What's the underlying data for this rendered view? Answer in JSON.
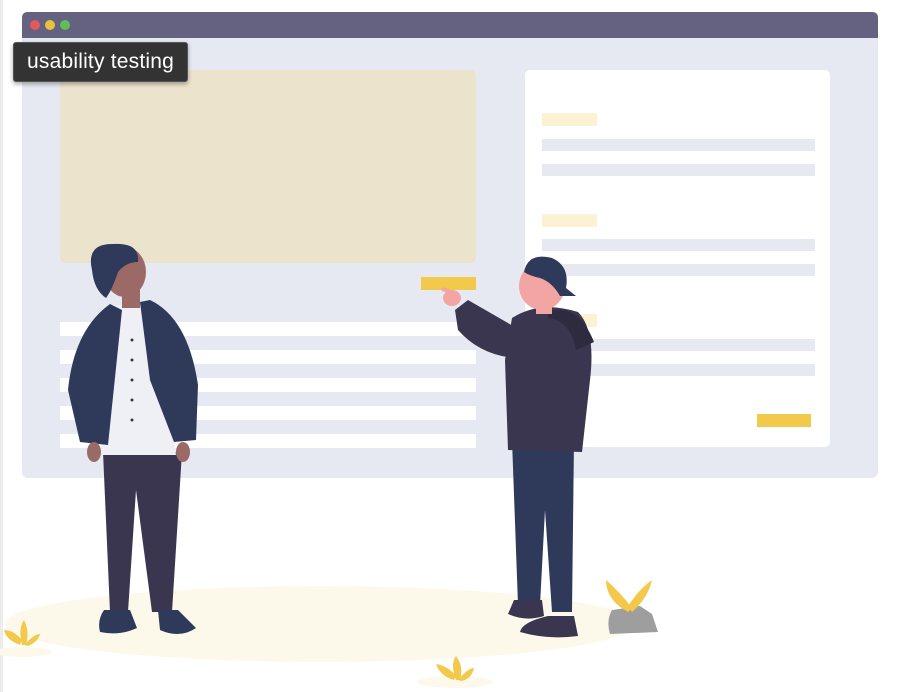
{
  "tooltip": {
    "text": "usability testing"
  },
  "colors": {
    "browser_bar": "#646280",
    "browser_body": "#e6e9f2",
    "dot_close": "#e1595a",
    "dot_minimize": "#e7c23f",
    "dot_maximize": "#5fbe5a",
    "hero_image": "#ebe3cc",
    "card": "#ffffff",
    "line": "#e6e9f2",
    "heading_bar": "#fcf2d3",
    "accent_button": "#f2c94a",
    "navy": "#2f3a5b",
    "dark_hoodie": "#3b3650",
    "skin_dark": "#9c6a66",
    "skin_light": "#f3a5a3",
    "ground": "#fdf9ea",
    "plant": "#f2c94a",
    "rock": "#9e9e9e"
  },
  "icons": [
    "window-close-dot-icon",
    "window-minimize-dot-icon",
    "window-maximize-dot-icon",
    "plant-icon",
    "rock-icon"
  ]
}
